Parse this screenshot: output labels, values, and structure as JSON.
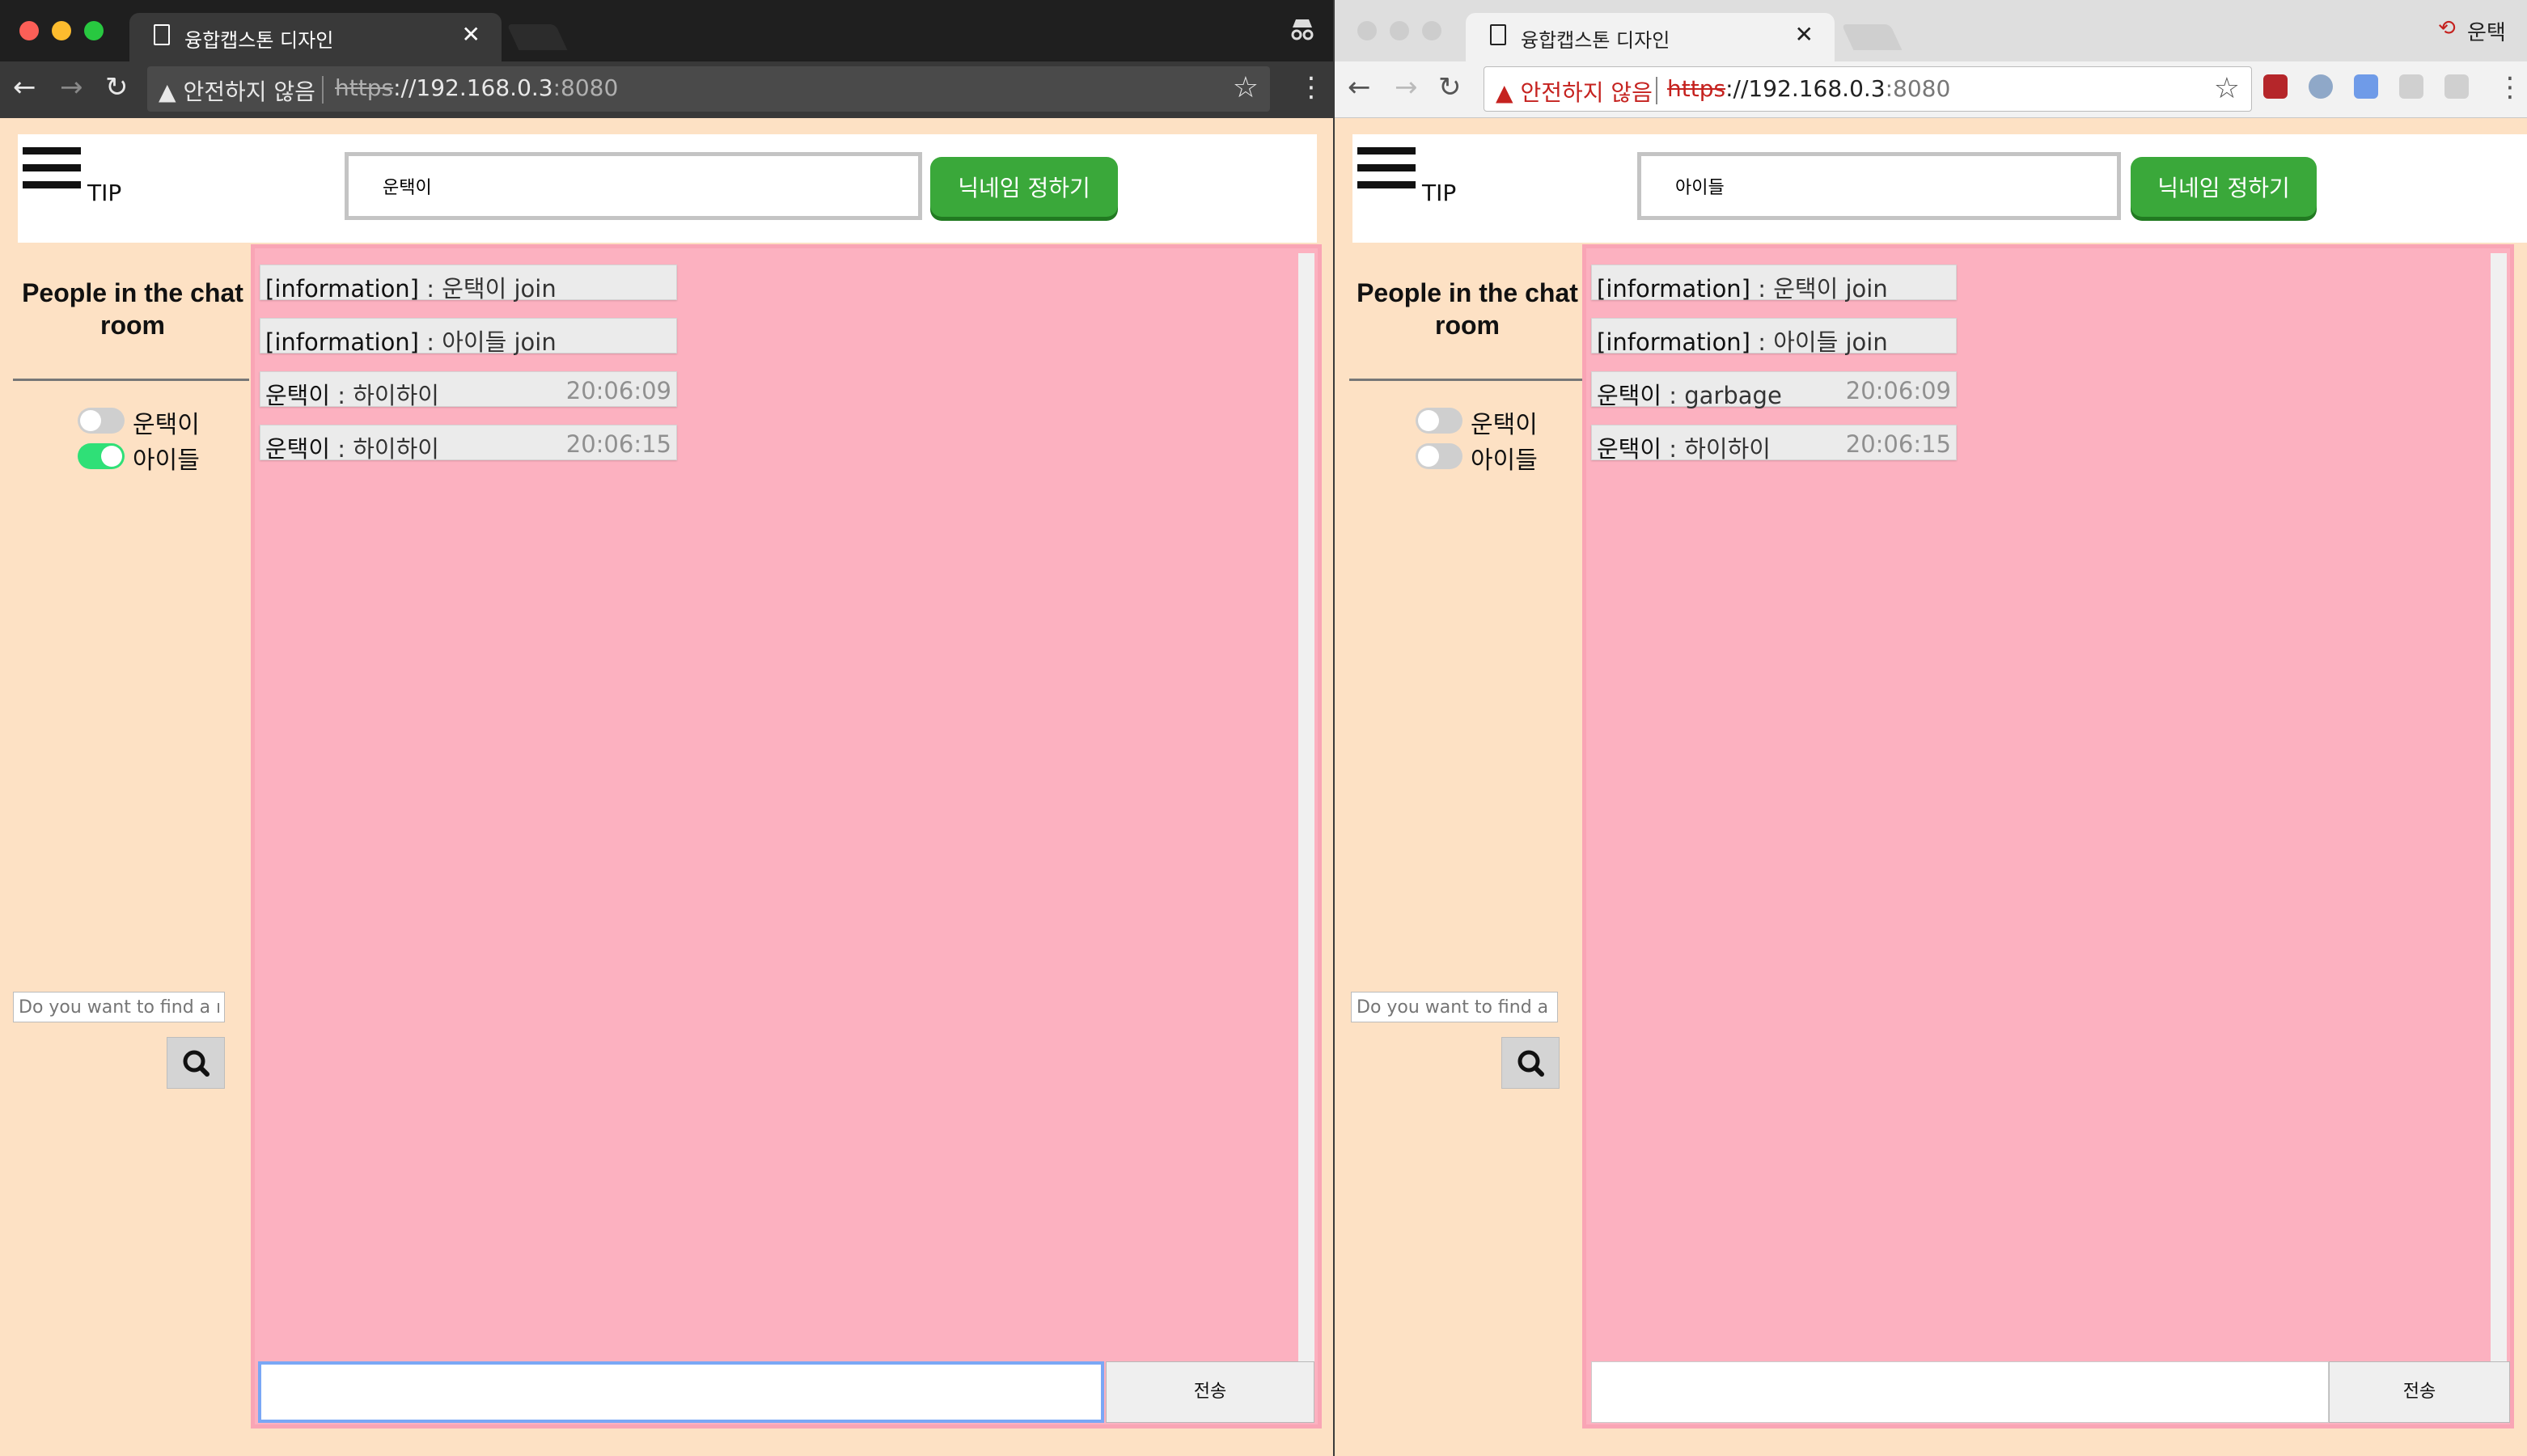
{
  "left_window": {
    "tab_title": "융합캡스톤 디자인",
    "security_label": "안전하지 않음",
    "url_scheme": "https",
    "url_host": "://192.168.0.3",
    "url_port": ":8080",
    "page": {
      "tip_label": "TIP",
      "nickname_value": "운택이",
      "nickname_button": "닉네임 정하기",
      "sidebar_title": "People in the chat room",
      "users": [
        {
          "name": "운택이",
          "toggle": "off"
        },
        {
          "name": "아이들",
          "toggle": "on"
        }
      ],
      "find_placeholder": "Do you want to find a ni",
      "messages": [
        {
          "sender": "[information]",
          "text": " : 운택이 join",
          "time": ""
        },
        {
          "sender": "[information]",
          "text": " : 아이들 join",
          "time": ""
        },
        {
          "sender": "운택이",
          "text": " : 하이하이",
          "time": "20:06:09"
        },
        {
          "sender": "운택이",
          "text": " : 하이하이",
          "time": "20:06:15"
        }
      ],
      "send_label": "전송",
      "message_value": ""
    }
  },
  "right_window": {
    "tab_title": "융합캡스톤 디자인",
    "security_label": "안전하지 않음",
    "url_scheme": "https",
    "url_host": "://192.168.0.3",
    "url_port": ":8080",
    "profile_label": "운택",
    "page": {
      "tip_label": "TIP",
      "nickname_value": "아이들",
      "nickname_button": "닉네임 정하기",
      "sidebar_title": "People in the chat room",
      "users": [
        {
          "name": "운택이",
          "toggle": "off"
        },
        {
          "name": "아이들",
          "toggle": "off"
        }
      ],
      "find_placeholder": "Do you want to find a ni",
      "messages": [
        {
          "sender": "[information]",
          "text": " : 운택이 join",
          "time": ""
        },
        {
          "sender": "[information]",
          "text": " : 아이들 join",
          "time": ""
        },
        {
          "sender": "운택이",
          "text": " : garbage",
          "time": "20:06:09"
        },
        {
          "sender": "운택이",
          "text": " : 하이하이",
          "time": "20:06:15"
        }
      ],
      "send_label": "전송",
      "message_value": ""
    }
  },
  "colors": {
    "page_bg": "#fde1c4",
    "chat_bg": "#fcb1c0",
    "button_green": "#3aa83a",
    "toggle_on": "#2fe077",
    "toggle_off": "#cfcfcf"
  },
  "icons": [
    "hamburger-icon",
    "search-icon",
    "star-icon",
    "back-icon",
    "forward-icon",
    "reload-icon",
    "warning-icon",
    "incognito-icon",
    "page-icon",
    "close-icon"
  ]
}
